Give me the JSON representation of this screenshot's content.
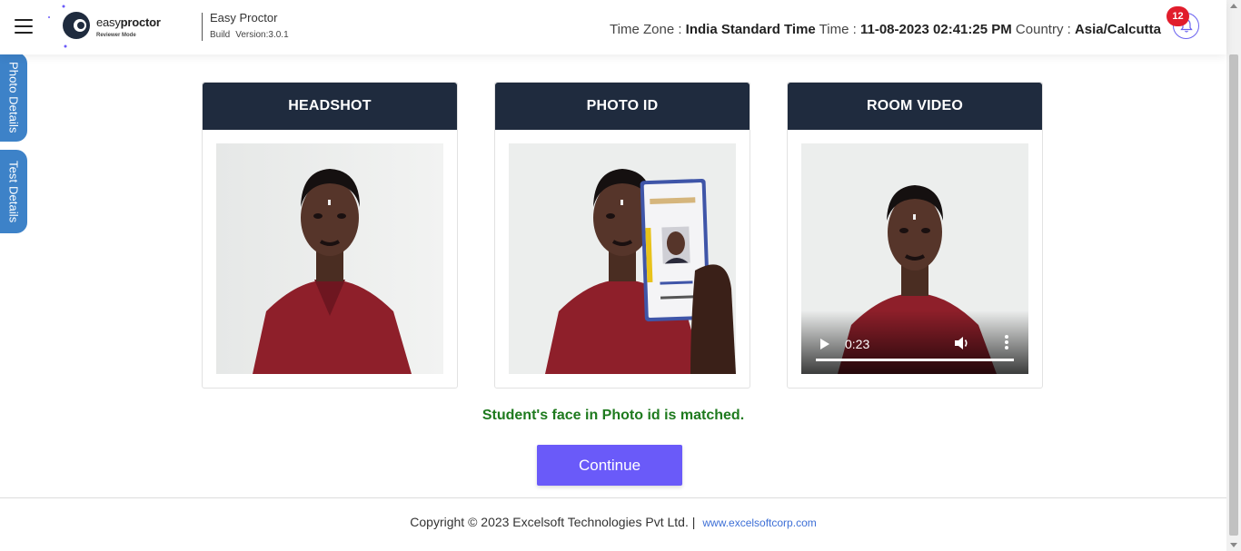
{
  "header": {
    "logo": {
      "brand_light": "easy",
      "brand_bold": "proctor",
      "mode": "Reviewer Mode"
    },
    "app_name": "Easy Proctor",
    "build_label": "Build",
    "version": "Version:3.0.1",
    "timezone_label": "Time Zone :",
    "timezone_value": "India Standard Time",
    "time_label": "Time :",
    "time_value": "11-08-2023 02:41:25 PM",
    "country_label": "Country :",
    "country_value": "Asia/Calcutta",
    "notification_count": "12"
  },
  "side_tabs": [
    {
      "label": "Photo Details"
    },
    {
      "label": "Test Details"
    }
  ],
  "cards": [
    {
      "title": "HEADSHOT",
      "media": "headshot-photo"
    },
    {
      "title": "PHOTO ID",
      "media": "photo-id-photo"
    },
    {
      "title": "ROOM VIDEO",
      "media": "room-video"
    }
  ],
  "video": {
    "time": "0:23",
    "progress": 1.0
  },
  "match_message": "Student's face in Photo id is matched.",
  "continue_label": "Continue",
  "footer": {
    "copyright": "Copyright © 2023 Excelsoft Technologies Pvt Ltd. |",
    "link": "www.excelsoftcorp.com"
  },
  "colors": {
    "header_bg": "#ffffff",
    "card_head_bg": "#1f2b3e",
    "accent": "#6a5af9",
    "side_tab": "#3d82c8",
    "match_text": "#1e7a1e",
    "badge": "#e11d2c"
  }
}
